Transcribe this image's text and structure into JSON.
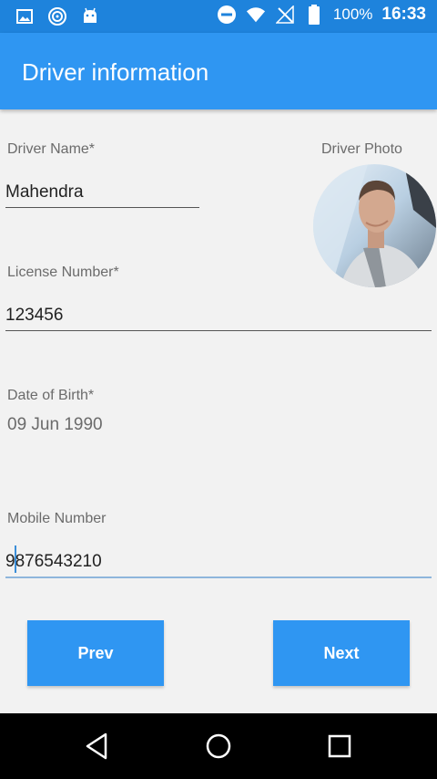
{
  "status_bar": {
    "battery_percent": "100%",
    "time": "16:33",
    "icons": [
      "image-icon",
      "sync-icon",
      "android-icon",
      "do-not-disturb-icon",
      "wifi-icon",
      "no-signal-icon",
      "battery-icon"
    ]
  },
  "app_bar": {
    "title": "Driver information"
  },
  "form": {
    "driver_name": {
      "label": "Driver Name*",
      "value": "Mahendra"
    },
    "driver_photo": {
      "label": "Driver Photo"
    },
    "license_number": {
      "label": "License Number*",
      "value": "123456"
    },
    "date_of_birth": {
      "label": "Date of Birth*",
      "value": "09 Jun 1990"
    },
    "mobile_number": {
      "label": "Mobile Number",
      "value": "9876543210"
    }
  },
  "buttons": {
    "prev": "Prev",
    "next": "Next"
  },
  "nav_bar": {
    "icons": [
      "back-icon",
      "home-icon",
      "recents-icon"
    ]
  },
  "colors": {
    "status_bar": "#1e83dc",
    "app_bar": "#2f96f2",
    "button": "#2f96f2",
    "background": "#f2f2f2"
  }
}
